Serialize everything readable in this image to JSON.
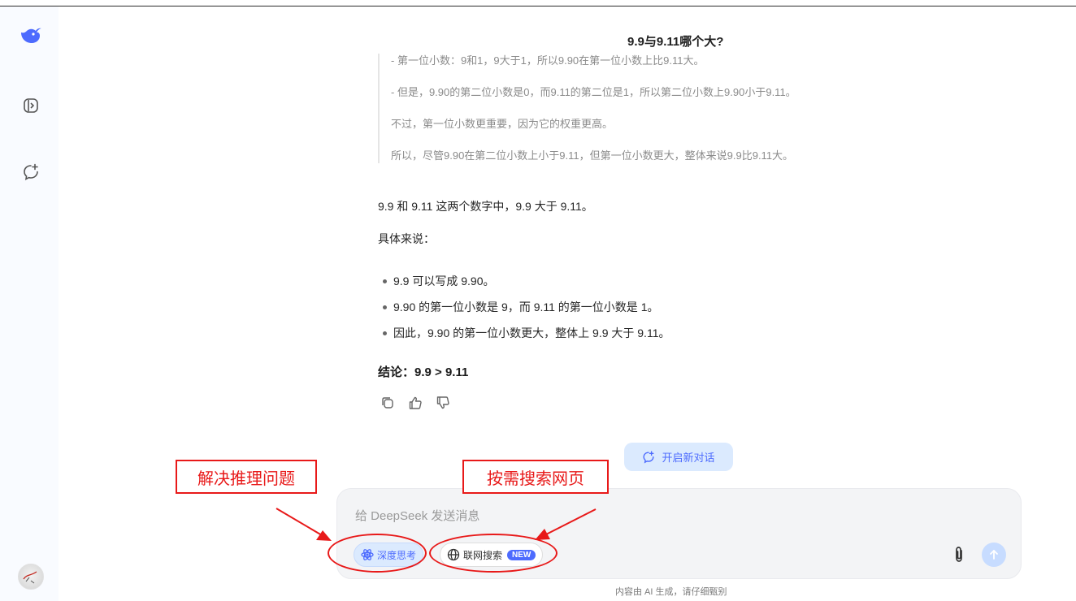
{
  "conversation": {
    "title": "9.9与9.11哪个大?",
    "thinking_lines": [
      "- 第一位小数：9和1，9大于1，所以9.90在第一位小数上比9.11大。",
      "- 但是，9.90的第二位小数是0，而9.11的第二位是1，所以第二位小数上9.90小于9.11。",
      "不过，第一位小数更重要，因为它的权重更高。",
      "所以，尽管9.90在第二位小数上小于9.11，但第一位小数更大，整体来说9.9比9.11大。"
    ],
    "answer_intro": "9.9 和 9.11 这两个数字中，9.9 大于 9.11。",
    "answer_sub": "具体来说：",
    "bullets": [
      "9.9 可以写成 9.90。",
      "9.90 的第一位小数是 9，而 9.11 的第一位小数是 1。",
      "因此，9.90 的第一位小数更大，整体上 9.9 大于 9.11。"
    ],
    "conclusion": "结论：9.9 > 9.11"
  },
  "new_chat_label": "开启新对话",
  "input": {
    "placeholder": "给 DeepSeek 发送消息",
    "deep_think_label": "深度思考",
    "web_search_label": "联网搜索",
    "web_search_badge": "NEW"
  },
  "disclaimer": "内容由 AI 生成，请仔细甄别",
  "annotations": {
    "left_callout": "解决推理问题",
    "right_callout": "按需搜索网页"
  },
  "icons": {
    "logo": "deepseek-whale-logo",
    "sidebar_toggle": "sidebar-toggle-icon",
    "new_chat": "new-chat-icon",
    "copy": "copy-icon",
    "like": "thumbs-up-icon",
    "dislike": "thumbs-down-icon",
    "deep_think": "atom-icon",
    "web_search": "globe-icon",
    "attach": "paperclip-icon",
    "send": "arrow-up-icon"
  },
  "colors": {
    "accent": "#4d6bfe",
    "annotation_red": "#e81919"
  }
}
